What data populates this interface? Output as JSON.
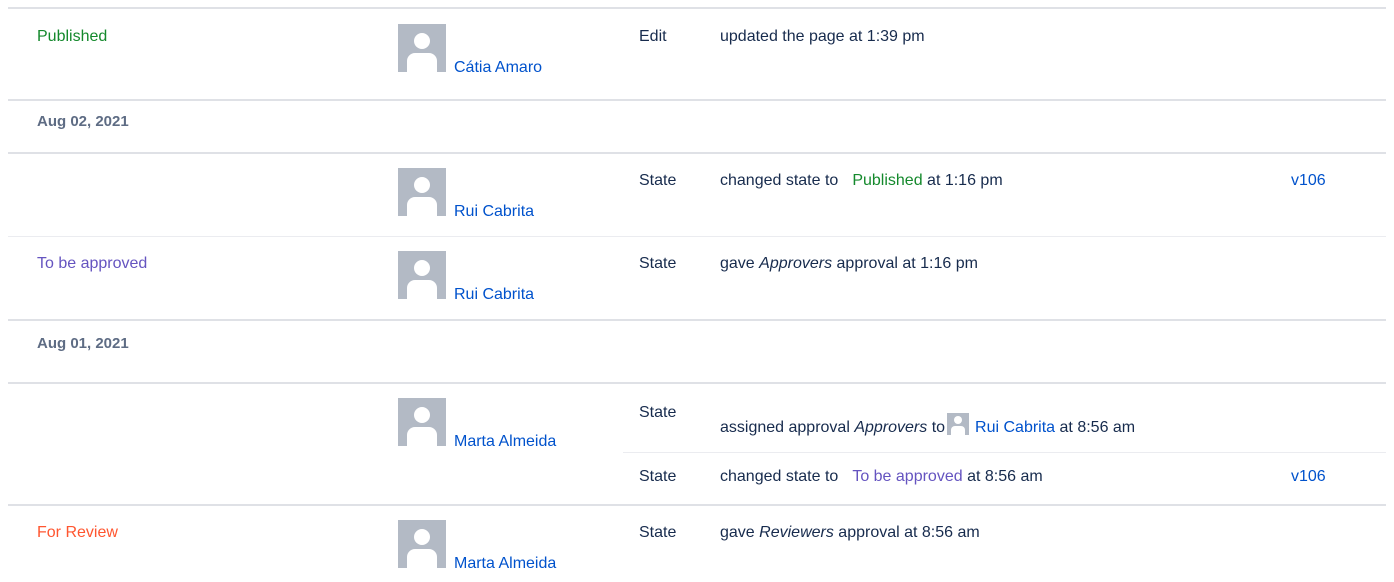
{
  "entries": [
    {
      "state": "Published",
      "user": "Cátia Amaro",
      "type": "Edit",
      "description": "updated the page at 1:39 pm"
    },
    {
      "date": "Aug 02, 2021"
    },
    {
      "user": "Rui Cabrita",
      "type": "State",
      "desc_prefix": "changed state to",
      "desc_state": "Published",
      "desc_suffix": "at 1:16 pm",
      "version": "v106"
    },
    {
      "state": "To be approved",
      "user": "Rui Cabrita",
      "type": "State",
      "desc_prefix": "gave",
      "desc_italic": "Approvers",
      "desc_suffix": "approval at 1:16 pm"
    },
    {
      "date": "Aug 01, 2021"
    },
    {
      "user": "Marta Almeida",
      "type": "State",
      "desc_prefix": "assigned approval",
      "desc_italic": "Approvers",
      "desc_mid": "to",
      "desc_user": "Rui Cabrita",
      "desc_suffix": "at 8:56 am",
      "sub": {
        "type": "State",
        "desc_prefix": "changed state to",
        "desc_state": "To be approved",
        "desc_suffix": "at 8:56 am",
        "version": "v106"
      }
    },
    {
      "state": "For Review",
      "user": "Marta Almeida",
      "type": "State",
      "desc_prefix": "gave",
      "desc_italic": "Reviewers",
      "desc_suffix": "approval at 8:56 am"
    }
  ],
  "colors": {
    "published": "#14892c",
    "to_be_approved": "#6554c0",
    "for_review": "#ff5630",
    "link": "#0052cc"
  }
}
